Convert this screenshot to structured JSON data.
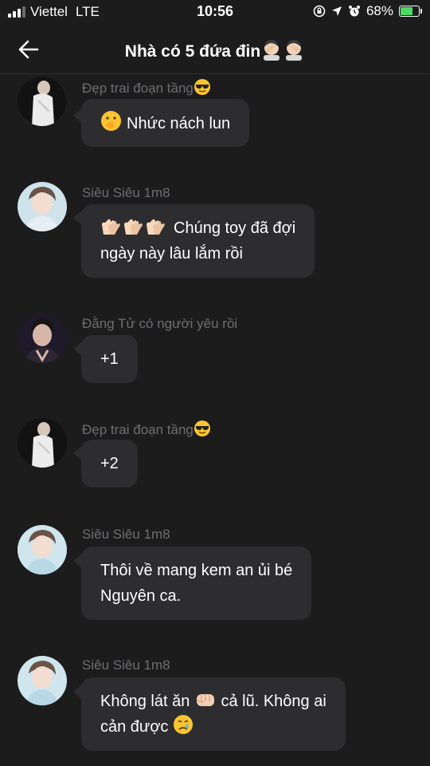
{
  "status_bar": {
    "carrier": "Viettel",
    "network": "LTE",
    "time": "10:56",
    "battery": "68%",
    "battery_level": 0.68,
    "accent": "#4cd964"
  },
  "header": {
    "title": "Nhà có 5 đứa đin",
    "back_icon": "arrow-left-icon"
  },
  "messages": [
    {
      "sender": "Đẹp trai đoạn tầng",
      "sender_emoji": "sunglasses-face",
      "text": "Nhức nách lun",
      "lead_emoji": "hand-over-mouth-face"
    },
    {
      "sender": "Siêu Siêu 1m8",
      "lines": [
        "Chúng toy đã đợi",
        "ngày này lâu lắm rồi"
      ],
      "lead_emoji": "clapping-hands"
    },
    {
      "sender": "Đằng Tử có người yêu rồi",
      "text": "+1"
    },
    {
      "sender": "Đẹp trai đoạn tầng",
      "sender_emoji": "sunglasses-face",
      "text": "+2"
    },
    {
      "sender": "Siêu Siêu 1m8",
      "lines": [
        "Thôi về mang kem an ủi bé",
        "Nguyên ca."
      ]
    },
    {
      "sender": "Siêu Siêu 1m8",
      "line1_a": "Không lát ăn",
      "line1_b": "cả lũ. Không ai",
      "line2": "cản được",
      "emojis": [
        "fist",
        "crying-face"
      ]
    }
  ]
}
